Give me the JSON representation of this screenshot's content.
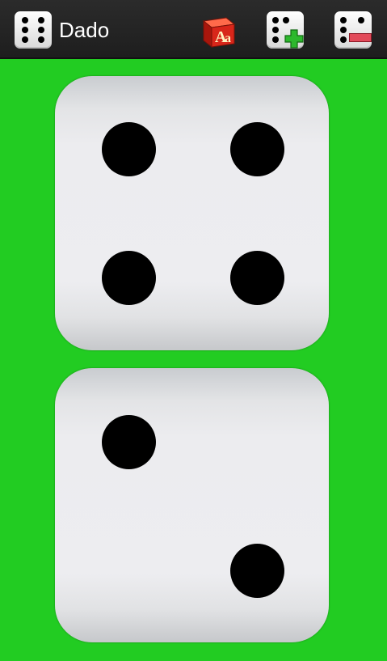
{
  "app": {
    "title": "Dado",
    "app_icon": "dice-four-icon"
  },
  "actions": [
    {
      "name": "abc-block-icon",
      "label": "Aa"
    },
    {
      "name": "add-die-icon"
    },
    {
      "name": "remove-die-icon"
    }
  ],
  "dice": [
    {
      "value": 4
    },
    {
      "value": 2
    }
  ],
  "colors": {
    "background": "#22cc22",
    "actionbar": "#232323",
    "pip": "#000000",
    "add": "#2db82d",
    "remove": "#e24a5a",
    "abc_block": "#cc2211"
  }
}
